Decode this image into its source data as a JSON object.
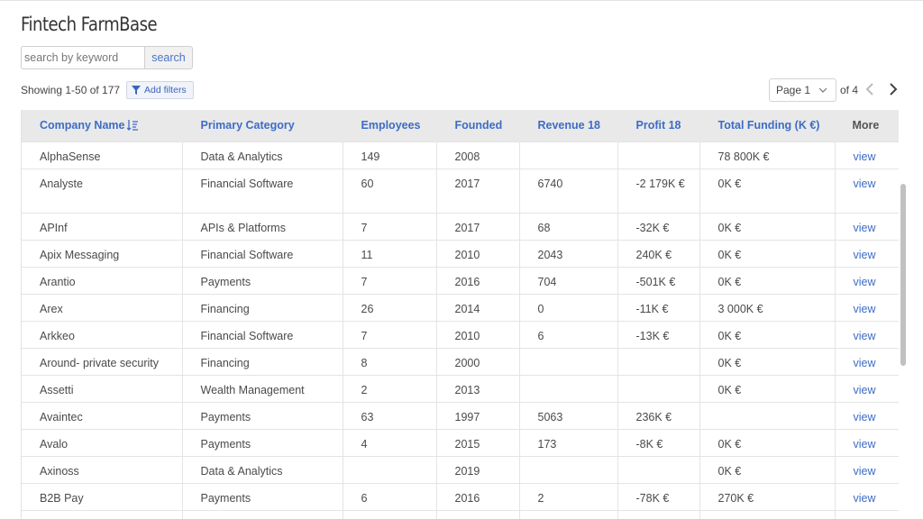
{
  "app": {
    "title": "Fintech FarmBase"
  },
  "search": {
    "placeholder": "search by keyword",
    "button_label": "search"
  },
  "results": {
    "showing": "Showing 1-50 of 177",
    "add_filters_label": "Add filters"
  },
  "pagination": {
    "current": "Page 1",
    "of": "of 4"
  },
  "table": {
    "headers": [
      "Company Name",
      "Primary Category",
      "Employees",
      "Founded",
      "Revenue 18",
      "Profit 18",
      "Total Funding (K €)",
      "More"
    ],
    "rows": [
      [
        "AlphaSense",
        "Data & Analytics",
        "149",
        "2008",
        "",
        "",
        "78 800K €",
        "view"
      ],
      [
        "Analyste",
        "Financial Software",
        "60",
        "2017",
        "6740",
        "-2 179K €",
        "0K €",
        "view"
      ],
      [
        "APInf",
        "APIs & Platforms",
        "7",
        "2017",
        "68",
        "-32K €",
        "0K €",
        "view"
      ],
      [
        "Apix Messaging",
        "Financial Software",
        "11",
        "2010",
        "2043",
        "240K €",
        "0K €",
        "view"
      ],
      [
        "Arantio",
        "Payments",
        "7",
        "2016",
        "704",
        "-501K €",
        "0K €",
        "view"
      ],
      [
        "Arex",
        "Financing",
        "26",
        "2014",
        "0",
        "-11K €",
        "3 000K €",
        "view"
      ],
      [
        "Arkkeo",
        "Financial Software",
        "7",
        "2010",
        "6",
        "-13K €",
        "0K €",
        "view"
      ],
      [
        "Around- private security",
        "Financing",
        "8",
        "2000",
        "",
        "",
        "0K €",
        "view"
      ],
      [
        "Assetti",
        "Wealth Management",
        "2",
        "2013",
        "",
        "",
        "0K €",
        "view"
      ],
      [
        "Avaintec",
        "Payments",
        "63",
        "1997",
        "5063",
        "236K €",
        "",
        "view"
      ],
      [
        "Avalo",
        "Payments",
        "4",
        "2015",
        "173",
        "-8K €",
        "0K €",
        "view"
      ],
      [
        "Axinoss",
        "Data & Analytics",
        "",
        "2019",
        "",
        "",
        "0K €",
        "view"
      ],
      [
        "B2B Pay",
        "Payments",
        "6",
        "2016",
        "2",
        "-78K €",
        "270K €",
        "view"
      ],
      [
        "",
        "",
        "",
        "",
        "",
        "",
        "",
        ""
      ]
    ]
  },
  "colors": {
    "accent": "#3d6cc6",
    "header_bg": "#e9e9e9",
    "border": "#e4e4e4"
  }
}
